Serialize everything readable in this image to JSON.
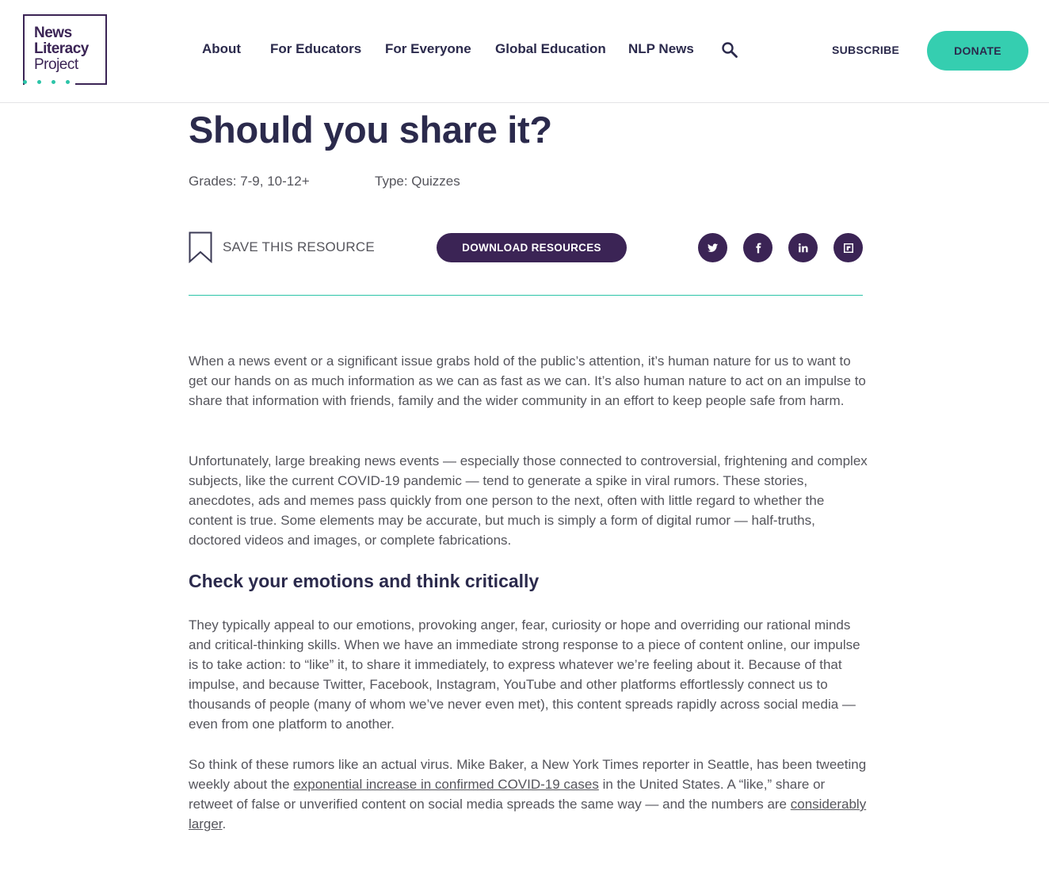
{
  "brand": {
    "logo_line1": "News",
    "logo_line2": "Literacy",
    "logo_line3": "Project",
    "colors": {
      "navy": "#2b2a4c",
      "purple": "#3b2455",
      "teal": "#35ceb0"
    }
  },
  "nav": {
    "items": [
      {
        "label": "About"
      },
      {
        "label": "For Educators"
      },
      {
        "label": "For Everyone"
      },
      {
        "label": "Global Education"
      },
      {
        "label": "NLP News"
      }
    ],
    "search_icon": "search-icon",
    "subscribe_label": "SUBSCRIBE",
    "donate_label": "DONATE"
  },
  "page": {
    "title": "Should you share it?",
    "grades": "Grades: 7-9, 10-12+",
    "type": "Type: Quizzes",
    "save_label": "SAVE THIS RESOURCE",
    "download_label": "DOWNLOAD RESOURCES",
    "share_icons": [
      "twitter-icon",
      "facebook-icon",
      "linkedin-icon",
      "flipboard-icon"
    ]
  },
  "body": {
    "p1": "When a news event or a significant issue grabs hold of the public’s attention, it’s human nature for us to want to get our hands on as much information as we can as fast as we can. It’s also human nature to act on an impulse to share that information with friends, family and the wider community in an effort to keep people safe from harm.",
    "p2": "Unfortunately, large breaking news events — especially those connected to controversial, frightening and complex subjects, like the current COVID-19 pandemic — tend to generate a spike in viral rumors. These stories, anecdotes, ads and memes pass quickly from one person to the next, often with little regard to whether the content is true. Some elements may be accurate, but much is simply a form of digital rumor — half-truths, doctored videos and images, or complete fabrications.",
    "heading": "Check your emotions and think critically",
    "p3": "They typically appeal to our emotions, provoking anger, fear, curiosity or hope and overriding our rational minds and critical-thinking skills. When we have an immediate strong response to a piece of content online, our impulse is to take action: to “like” it, to share it immediately, to express whatever we’re feeling about it. Because of that impulse, and because Twitter, Facebook, Instagram, YouTube and other platforms effortlessly connect us to thousands of people (many of whom we’ve never even met), this content spreads rapidly across social media — even from one platform to another.",
    "p4_a": "So think of these rumors like an actual virus. Mike Baker, a New York Times reporter in Seattle, has been tweeting weekly about the ",
    "p4_link1": "exponential increase in confirmed COVID-19 cases",
    "p4_b": " in the United States. A “like,” share or retweet of false or unverified content on social media spreads the same way — and the numbers are ",
    "p4_link2": "considerably larger",
    "p4_c": "."
  }
}
